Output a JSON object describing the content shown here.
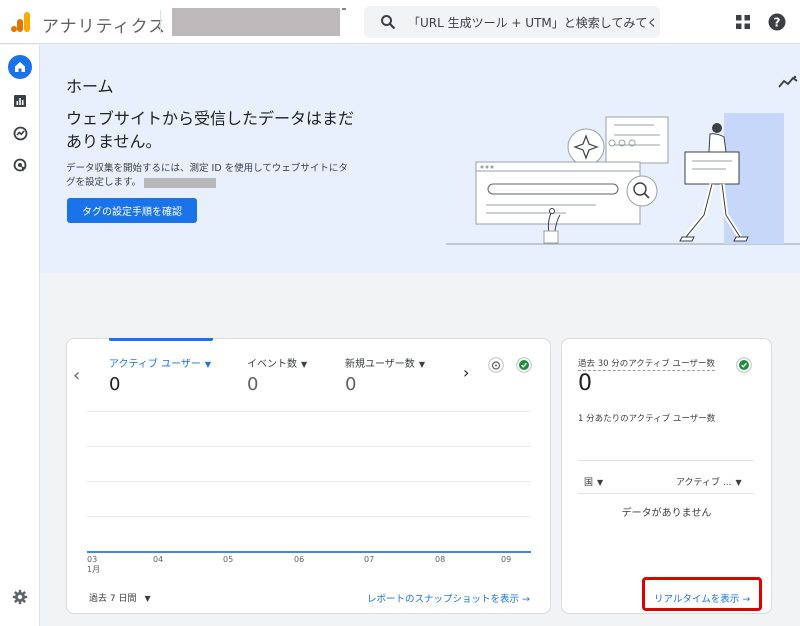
{
  "app": {
    "title": "アナリティクス"
  },
  "search": {
    "text": "「URL 生成ツール + UTM」と検索してみてくだ..."
  },
  "colors": {
    "accent": "#1a73e8",
    "hero_bg": "#e8f0fe",
    "highlight": "#e00000"
  },
  "icons": {
    "logo": "analytics-logo-icon",
    "search": "search-icon",
    "apps": "apps-grid-icon",
    "help": "help-icon",
    "home": "home-icon",
    "reports": "reports-icon",
    "explore": "explore-icon",
    "advertising": "advertising-icon",
    "settings": "gear-icon",
    "insights": "trend-icon"
  },
  "hero": {
    "header": "ホーム",
    "title": "ウェブサイトから受信したデータはまだありません。",
    "description": "データ収集を開始するには、測定 ID を使用してウェブサイトにタグを設定します。",
    "button": "タグの設定手順を確認"
  },
  "overview": {
    "metrics": [
      {
        "label": "アクティブ ユーザー",
        "value": "0"
      },
      {
        "label": "イベント数",
        "value": "0"
      },
      {
        "label": "新規ユーザー数",
        "value": "0"
      }
    ],
    "x_ticks": [
      "03",
      "04",
      "05",
      "06",
      "07",
      "08",
      "09"
    ],
    "x_month": "1月",
    "period": "過去 7 日間",
    "snapshot_link": "レポートのスナップショットを表示 →"
  },
  "realtime": {
    "title": "過去 30 分のアクティブ ユーザー数",
    "value": "0",
    "subtitle": "1 分あたりのアクティブ ユーザー数",
    "col_country": "国",
    "col_users": "アクティブ ...",
    "empty": "データがありません",
    "link": "リアルタイムを表示 →"
  }
}
